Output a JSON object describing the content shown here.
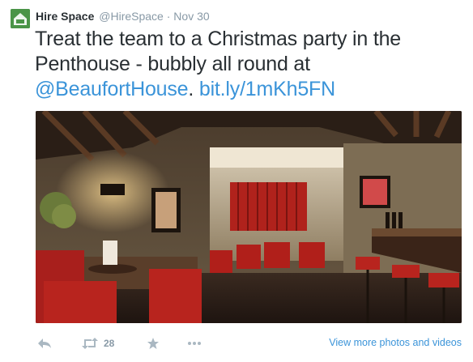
{
  "tweet": {
    "author_name": "Hire Space",
    "author_handle": "@HireSpace",
    "separator": "·",
    "timestamp": "Nov 30",
    "text_before": "Treat the team to a Christmas party in the Penthouse - bubbly all round at ",
    "mention": "@BeaufortHouse",
    "text_middle": ". ",
    "link": "bit.ly/1mKh5FN"
  },
  "avatar": {
    "icon": "hire-space-logo",
    "color": "#4a9447"
  },
  "media": {
    "description_icon": "bar-interior-photo"
  },
  "actions": {
    "reply_icon": "reply-icon",
    "retweet_icon": "retweet-icon",
    "retweet_count": "28",
    "favorite_icon": "star-icon",
    "more_icon": "ellipsis-icon",
    "view_more_label": "View more photos and videos"
  },
  "colors": {
    "link": "#3b94d9",
    "meta": "#8899a6",
    "text": "#292f33"
  }
}
